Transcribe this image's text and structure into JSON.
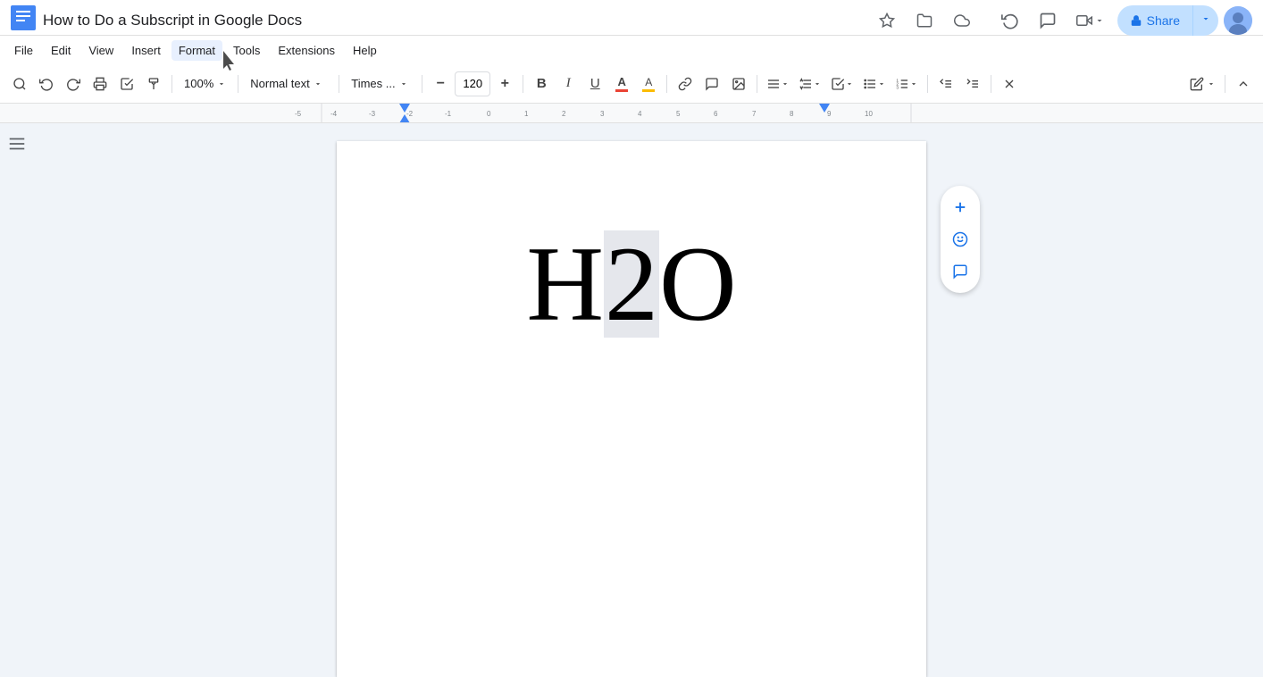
{
  "titlebar": {
    "doc_title": "How to Do a Subscript in Google Docs",
    "app_icon_color": "#4285f4",
    "share_label": "Share",
    "share_lock_icon": "🔒"
  },
  "menubar": {
    "items": [
      "File",
      "Edit",
      "View",
      "Insert",
      "Format",
      "Tools",
      "Extensions",
      "Help"
    ],
    "active": "Format"
  },
  "toolbar": {
    "zoom": "100%",
    "style": "Normal text",
    "font": "Times ...",
    "font_size": "120",
    "undo_icon": "↩",
    "redo_icon": "↪",
    "print_icon": "🖨",
    "spellcheck_icon": "✓",
    "paintformat_icon": "🎨",
    "bold_label": "B",
    "italic_label": "I",
    "underline_label": "U",
    "text_color_icon": "A",
    "highlight_icon": "A",
    "link_icon": "🔗",
    "comment_icon": "💬",
    "image_icon": "🖼",
    "align_icon": "≡",
    "spacing_icon": "↕",
    "checklist_icon": "☑",
    "bullets_icon": "☰",
    "numbered_icon": "1.",
    "indent_less_icon": "←",
    "indent_more_icon": "→",
    "clear_format_icon": "✗",
    "pencil_icon": "✏",
    "expand_icon": "⌃"
  },
  "document": {
    "content": "H₂O",
    "h_text": "H",
    "two_text": "2",
    "o_text": "O",
    "font_size_doc": "120px"
  },
  "side_actions": {
    "add_icon": "➕",
    "emoji_icon": "☺",
    "comment_icon": "💬"
  },
  "cursor_position": "Format menu area"
}
